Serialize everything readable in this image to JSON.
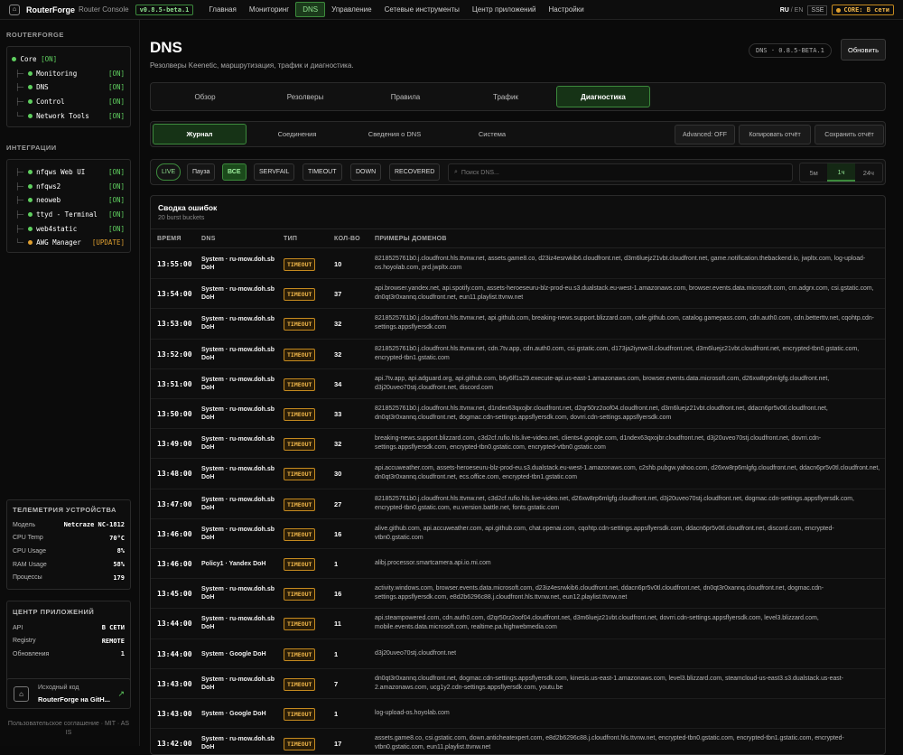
{
  "topbar": {
    "brand": "RouterForge",
    "subtitle": "Router Console",
    "version": "v0.8.5-beta.1",
    "nav": [
      "Главная",
      "Мониторинг",
      "DNS",
      "Управление",
      "Сетевые инструменты",
      "Центр приложений",
      "Настройки"
    ],
    "active_nav": "DNS",
    "lang_ru": "RU",
    "lang_sep": "/",
    "lang_en": "EN",
    "sse": "SSE",
    "core_status": "CORE: В сети"
  },
  "sidebar": {
    "title": "ROUTERFORGE",
    "core": {
      "label": "Core",
      "status": "[ON]"
    },
    "modules": [
      {
        "prefix": "├─",
        "label": "Monitoring",
        "status": "[ON]"
      },
      {
        "prefix": "├─",
        "label": "DNS",
        "status": "[ON]"
      },
      {
        "prefix": "├─",
        "label": "Control",
        "status": "[ON]"
      },
      {
        "prefix": "└─",
        "label": "Network Tools",
        "status": "[ON]"
      }
    ],
    "integrations_title": "ИНТЕГРАЦИИ",
    "integrations": [
      {
        "prefix": "├─",
        "label": "nfqws Web UI",
        "status": "[ON]"
      },
      {
        "prefix": "├─",
        "label": "nfqws2",
        "status": "[ON]"
      },
      {
        "prefix": "├─",
        "label": "neoweb",
        "status": "[ON]"
      },
      {
        "prefix": "├─",
        "label": "ttyd - Terminal",
        "status": "[ON]"
      },
      {
        "prefix": "├─",
        "label": "web4static",
        "status": "[ON]"
      },
      {
        "prefix": "└─",
        "label": "AWG Manager",
        "status": "[UPDATE]"
      }
    ],
    "telemetry_title": "ТЕЛЕМЕТРИЯ УСТРОЙСТВА",
    "telemetry": [
      {
        "label": "Модель",
        "value": "Netcraze NC-1812"
      },
      {
        "label": "CPU Temp",
        "value": "70°C"
      },
      {
        "label": "CPU Usage",
        "value": "8%"
      },
      {
        "label": "RAM Usage",
        "value": "58%"
      },
      {
        "label": "Процессы",
        "value": "179"
      }
    ],
    "appcenter_title": "ЦЕНТР ПРИЛОЖЕНИЙ",
    "appcenter": [
      {
        "label": "API",
        "value": "В СЕТИ"
      },
      {
        "label": "Registry",
        "value": "REMOTE"
      },
      {
        "label": "Обновления",
        "value": "1"
      }
    ],
    "source_label": "Исходный код",
    "source_link": "RouterForge на GitH...",
    "footer": "Пользовательское соглашение · MIT · AS IS"
  },
  "main": {
    "title": "DNS",
    "subtitle": "Резолверы Keenetic, маршрутизация, трафик и диагностика.",
    "version_badge": "DNS · 0.8.5-BETA.1",
    "update_button": "Обновить",
    "tabs": [
      "Обзор",
      "Резолверы",
      "Правила",
      "Трафик",
      "Диагностика"
    ],
    "subtabs": [
      "Журнал",
      "Соединения",
      "Сведения о DNS",
      "Система"
    ],
    "advanced": "Advanced: OFF",
    "copy_report": "Копировать отчёт",
    "save_report": "Сохранить отчёт",
    "filters": {
      "live": "LIVE",
      "pause": "Пауза",
      "all": "ВСЕ",
      "servfail": "SERVFAIL",
      "timeout": "TIMEOUT",
      "down": "DOWN",
      "recovered": "RECOVERED",
      "search_placeholder": "Поиск DNS...",
      "ranges": [
        "5м",
        "1ч",
        "24ч"
      ]
    },
    "summary": {
      "title": "Сводка ошибок",
      "subtitle": "20 burst buckets"
    },
    "columns": [
      "ВРЕМЯ",
      "DNS",
      "ТИП",
      "КОЛ-ВО",
      "ПРИМЕРЫ ДОМЕНОВ"
    ],
    "rows": [
      {
        "time": "13:55:00",
        "dns": "System · ru-mow.doh.sb DoH",
        "type": "TIMEOUT",
        "count": "10",
        "domains": "8218525761b0.j.cloudfront.hls.ttvnw.net, assets.game8.co, d23iz4esrwkib6.cloudfront.net, d3m6luejz21vbt.cloudfront.net, game.notification.thebackend.io, jwpltx.com, log-upload-os.hoyolab.com, prd.jwpltx.com"
      },
      {
        "time": "13:54:00",
        "dns": "System · ru-mow.doh.sb DoH",
        "type": "TIMEOUT",
        "count": "37",
        "domains": "api.browser.yandex.net, api.spotify.com, assets-heroeseuru-blz-prod-eu.s3.dualstack.eu-west-1.amazonaws.com, browser.events.data.microsoft.com, cm.adgrx.com, csi.gstatic.com, dn0qt3r0xannq.cloudfront.net, eun11.playlist.ttvnw.net"
      },
      {
        "time": "13:53:00",
        "dns": "System · ru-mow.doh.sb DoH",
        "type": "TIMEOUT",
        "count": "32",
        "domains": "8218525761b0.j.cloudfront.hls.ttvnw.net, api.github.com, breaking-news.support.blizzard.com, cafe.github.com, catalog.gamepass.com, cdn.auth0.com, cdn.betterttv.net, cqohtp.cdn-settings.appsflyersdk.com"
      },
      {
        "time": "13:52:00",
        "dns": "System · ru-mow.doh.sb DoH",
        "type": "TIMEOUT",
        "count": "32",
        "domains": "8218525761b0.j.cloudfront.hls.ttvnw.net, cdn.7tv.app, cdn.auth0.com, csi.gstatic.com, d173ja2iyrwe3l.cloudfront.net, d3m6luejz21vbt.cloudfront.net, encrypted-tbn0.gstatic.com, encrypted-tbn1.gstatic.com"
      },
      {
        "time": "13:51:00",
        "dns": "System · ru-mow.doh.sb DoH",
        "type": "TIMEOUT",
        "count": "34",
        "domains": "api.7tv.app, api.adguard.org, api.github.com, b6y6lf1s29.execute-api.us-east-1.amazonaws.com, browser.events.data.microsoft.com, d26xw8rp6mlgfg.cloudfront.net, d3j20uveo70stj.cloudfront.net, discord.com"
      },
      {
        "time": "13:50:00",
        "dns": "System · ru-mow.doh.sb DoH",
        "type": "TIMEOUT",
        "count": "33",
        "domains": "8218525761b0.j.cloudfront.hls.ttvnw.net, d1ndex63qxojbr.cloudfront.net, d2qr50rz2oof04.cloudfront.net, d3m6luejz21vbt.cloudfront.net, ddacn6pr5v0tl.cloudfront.net, dn0qt3r0xannq.cloudfront.net, dogmac.cdn-settings.appsflyersdk.com, dovrri.cdn-settings.appsflyersdk.com"
      },
      {
        "time": "13:49:00",
        "dns": "System · ru-mow.doh.sb DoH",
        "type": "TIMEOUT",
        "count": "32",
        "domains": "breaking-news.support.blizzard.com, c3d2cf.rufio.hls.live-video.net, clients4.google.com, d1ndex63qxojbr.cloudfront.net, d3j20uveo70stj.cloudfront.net, dovrri.cdn-settings.appsflyersdk.com, encrypted-tbn0.gstatic.com, encrypted-vtbn0.gstatic.com"
      },
      {
        "time": "13:48:00",
        "dns": "System · ru-mow.doh.sb DoH",
        "type": "TIMEOUT",
        "count": "30",
        "domains": "api.accuweather.com, assets-heroeseuru-blz-prod-eu.s3.dualstack.eu-west-1.amazonaws.com, c2shb.pubgw.yahoo.com, d26xw8rp6mlgfg.cloudfront.net, ddacn6pr5v0tl.cloudfront.net, dn0qt3r0xannq.cloudfront.net, ecs.office.com, encrypted-tbn1.gstatic.com"
      },
      {
        "time": "13:47:00",
        "dns": "System · ru-mow.doh.sb DoH",
        "type": "TIMEOUT",
        "count": "27",
        "domains": "8218525761b0.j.cloudfront.hls.ttvnw.net, c3d2cf.rufio.hls.live-video.net, d26xw8rp6mlgfg.cloudfront.net, d3j20uveo70stj.cloudfront.net, dogmac.cdn-settings.appsflyersdk.com, encrypted-tbn0.gstatic.com, eu.version.battle.net, fonts.gstatic.com"
      },
      {
        "time": "13:46:00",
        "dns": "System · ru-mow.doh.sb DoH",
        "type": "TIMEOUT",
        "count": "16",
        "domains": "alive.github.com, api.accuweather.com, api.github.com, chat.openai.com, cqohtp.cdn-settings.appsflyersdk.com, ddacn6pr5v0tl.cloudfront.net, discord.com, encrypted-vtbn0.gstatic.com"
      },
      {
        "time": "13:46:00",
        "dns": "Policy1 · Yandex DoH",
        "type": "TIMEOUT",
        "count": "1",
        "domains": "alibj.processor.smartcamera.api.io.mi.com"
      },
      {
        "time": "13:45:00",
        "dns": "System · ru-mow.doh.sb DoH",
        "type": "TIMEOUT",
        "count": "16",
        "domains": "activity.windows.com, browser.events.data.microsoft.com, d23iz4esrwkib6.cloudfront.net, ddacn6pr5v0tl.cloudfront.net, dn0qt3r0xannq.cloudfront.net, dogmac.cdn-settings.appsflyersdk.com, e8d2b6296c88.j.cloudfront.hls.ttvnw.net, eun12.playlist.ttvnw.net"
      },
      {
        "time": "13:44:00",
        "dns": "System · ru-mow.doh.sb DoH",
        "type": "TIMEOUT",
        "count": "11",
        "domains": "api.steampowered.com, cdn.auth0.com, d2qr50rz2oof04.cloudfront.net, d3m6luejz21vbt.cloudfront.net, dovrri.cdn-settings.appsflyersdk.com, level3.blizzard.com, mobile.events.data.microsoft.com, realtime.pa.highwebmedia.com"
      },
      {
        "time": "13:44:00",
        "dns": "System · Google DoH",
        "type": "TIMEOUT",
        "count": "1",
        "domains": "d3j20uveo70stj.cloudfront.net"
      },
      {
        "time": "13:43:00",
        "dns": "System · ru-mow.doh.sb DoH",
        "type": "TIMEOUT",
        "count": "7",
        "domains": "dn0qt3r0xannq.cloudfront.net, dogmac.cdn-settings.appsflyersdk.com, kinesis.us-east-1.amazonaws.com, level3.blizzard.com, steamcloud-us-east3.s3.dualstack.us-east-2.amazonaws.com, ucg1y2.cdn-settings.appsflyersdk.com, youtu.be"
      },
      {
        "time": "13:43:00",
        "dns": "System · Google DoH",
        "type": "TIMEOUT",
        "count": "1",
        "domains": "log-upload-os.hoyolab.com"
      },
      {
        "time": "13:42:00",
        "dns": "System · ru-mow.doh.sb DoH",
        "type": "TIMEOUT",
        "count": "17",
        "domains": "assets.game8.co, csi.gstatic.com, down.anticheatexpert.com, e8d2b6296c88.j.cloudfront.hls.ttvnw.net, encrypted-tbn0.gstatic.com, encrypted-tbn1.gstatic.com, encrypted-vtbn0.gstatic.com, eun11.playlist.ttvnw.net"
      }
    ]
  },
  "colors": {
    "accent_green": "#3c8a3c",
    "warn_orange": "#f0b64a",
    "bg": "#0a0a0a"
  }
}
